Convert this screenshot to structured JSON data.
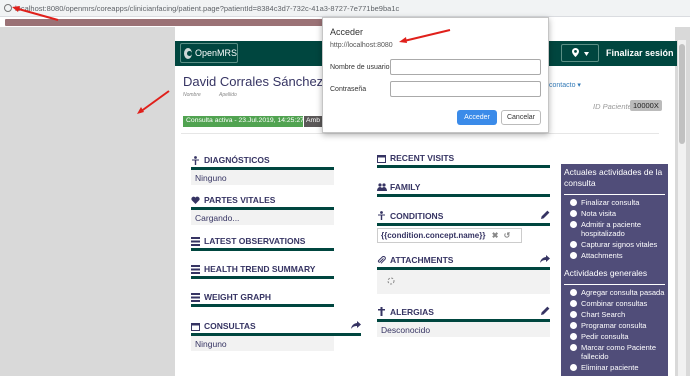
{
  "browser": {
    "url": "localhost:8080/openmrs/coreapps/clinicianfacing/patient.page?patientId=8384c3d7-732c-41a3-8727-7e771be9ba1c"
  },
  "header": {
    "logo_text": "OpenMRS",
    "logout_label": "Finalizar sesión"
  },
  "patient": {
    "name": "David Corrales Sánchez",
    "given_label": "Nombre",
    "family_label": "Apellido",
    "contact_link": "contacto",
    "id_label": "ID Paciente",
    "id_value": "10000X",
    "visit_badge": "Consulta activa - 23.Jul.2019, 14:25:27",
    "visit_type_badge": "Amb"
  },
  "widgets": {
    "diagnoses": {
      "title": "DIAGNÓSTICOS",
      "value": "Ninguno"
    },
    "vitals": {
      "title": "PARTES VITALES",
      "value": "Cargando..."
    },
    "latest_obs": {
      "title": "LATEST OBSERVATIONS"
    },
    "health_trend": {
      "title": "HEALTH TREND SUMMARY"
    },
    "weight": {
      "title": "WEIGHT GRAPH"
    },
    "visits_left": {
      "title": "CONSULTAS",
      "value": "Ninguno"
    },
    "recent_visits": {
      "title": "RECENT VISITS"
    },
    "family": {
      "title": "FAMILY"
    },
    "conditions": {
      "title": "CONDITIONS",
      "value": "{{condition.concept.name}}"
    },
    "attachments": {
      "title": "ATTACHMENTS"
    },
    "allergies": {
      "title": "ALERGIAS",
      "value": "Desconocido"
    }
  },
  "sidebar": {
    "current_header": "Actuales actividades de la consulta",
    "current_items": [
      "Finalizar consulta",
      "Nota visita",
      "Admitir a paciente hospitalizado",
      "Capturar signos vitales",
      "Attachments"
    ],
    "general_header": "Actividades generales",
    "general_items": [
      "Agregar consulta pasada",
      "Combinar consultas",
      "Chart Search",
      "Programar consulta",
      "Pedir consulta",
      "Marcar como Paciente fallecido",
      "Eliminar paciente"
    ]
  },
  "dialog": {
    "title": "Acceder",
    "origin": "http://localhost:8080",
    "username_label": "Nombre de usuario",
    "password_label": "Contraseña",
    "login_button": "Acceder",
    "cancel_button": "Cancelar"
  },
  "colors": {
    "header": "#00463f",
    "sidebar": "#504d79",
    "visit_badge": "#51a351",
    "annotation_arrow": "#e0201b",
    "primary_button": "#3b8be9"
  }
}
